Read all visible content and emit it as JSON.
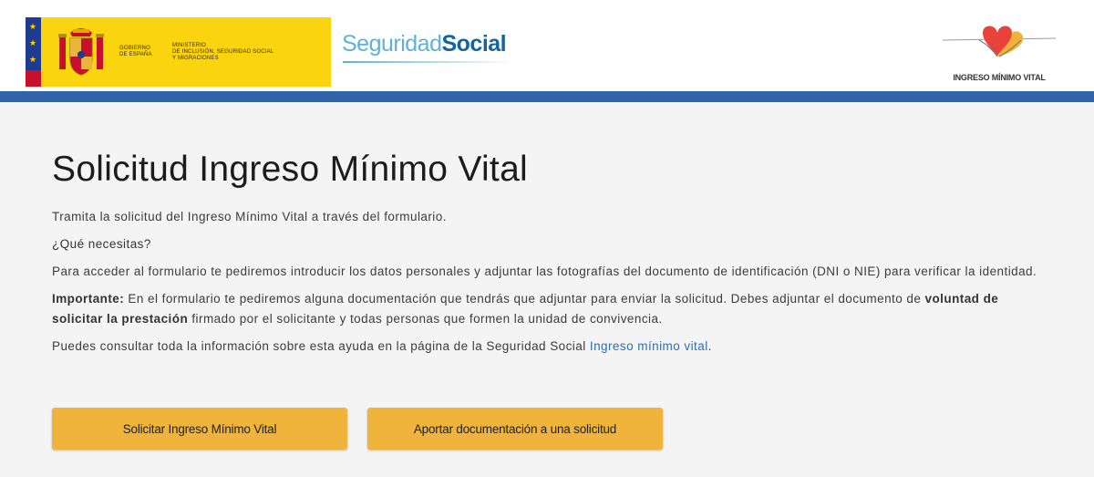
{
  "header": {
    "gov_label_line1": "GOBIERNO",
    "gov_label_line2": "DE ESPAÑA",
    "ministry_line1": "MINISTERIO",
    "ministry_line2": "DE INCLUSIÓN, SEGURIDAD SOCIAL",
    "ministry_line3": "Y MIGRACIONES",
    "ss_logo_light": "Seguridad",
    "ss_logo_bold": "Social",
    "imv_logo_text": "INGRESO MÍNIMO VITAL"
  },
  "main": {
    "title": "Solicitud Ingreso Mínimo Vital",
    "intro": "Tramita la solicitud del Ingreso Mínimo Vital a través del formulario.",
    "needs_heading": "¿Qué necesitas?",
    "needs_text": "Para acceder al formulario te pediremos introducir los datos personales y adjuntar las fotografías del documento de identificación (DNI o NIE) para verificar la identidad.",
    "important_label": "Importante:",
    "important_text_1": " En el formulario te pediremos alguna documentación que tendrás que adjuntar para enviar la solicitud. Debes adjuntar el documento de ",
    "important_bold": "voluntad de solicitar la prestación",
    "important_text_2": " firmado por el solicitante y todas personas que formen la unidad de convivencia.",
    "info_text": "Puedes consultar toda la información sobre esta ayuda en la página de la Seguridad Social ",
    "info_link": "Ingreso mínimo vital",
    "info_end": "."
  },
  "buttons": {
    "apply_label": "Solicitar Ingreso Mínimo Vital",
    "docs_label": "Aportar documentación a una solicitud"
  },
  "colors": {
    "gov_yellow": "#fad40e",
    "blue_bar": "#2f64a8",
    "button_orange": "#f0b43c",
    "link_blue": "#2c6fb0"
  }
}
